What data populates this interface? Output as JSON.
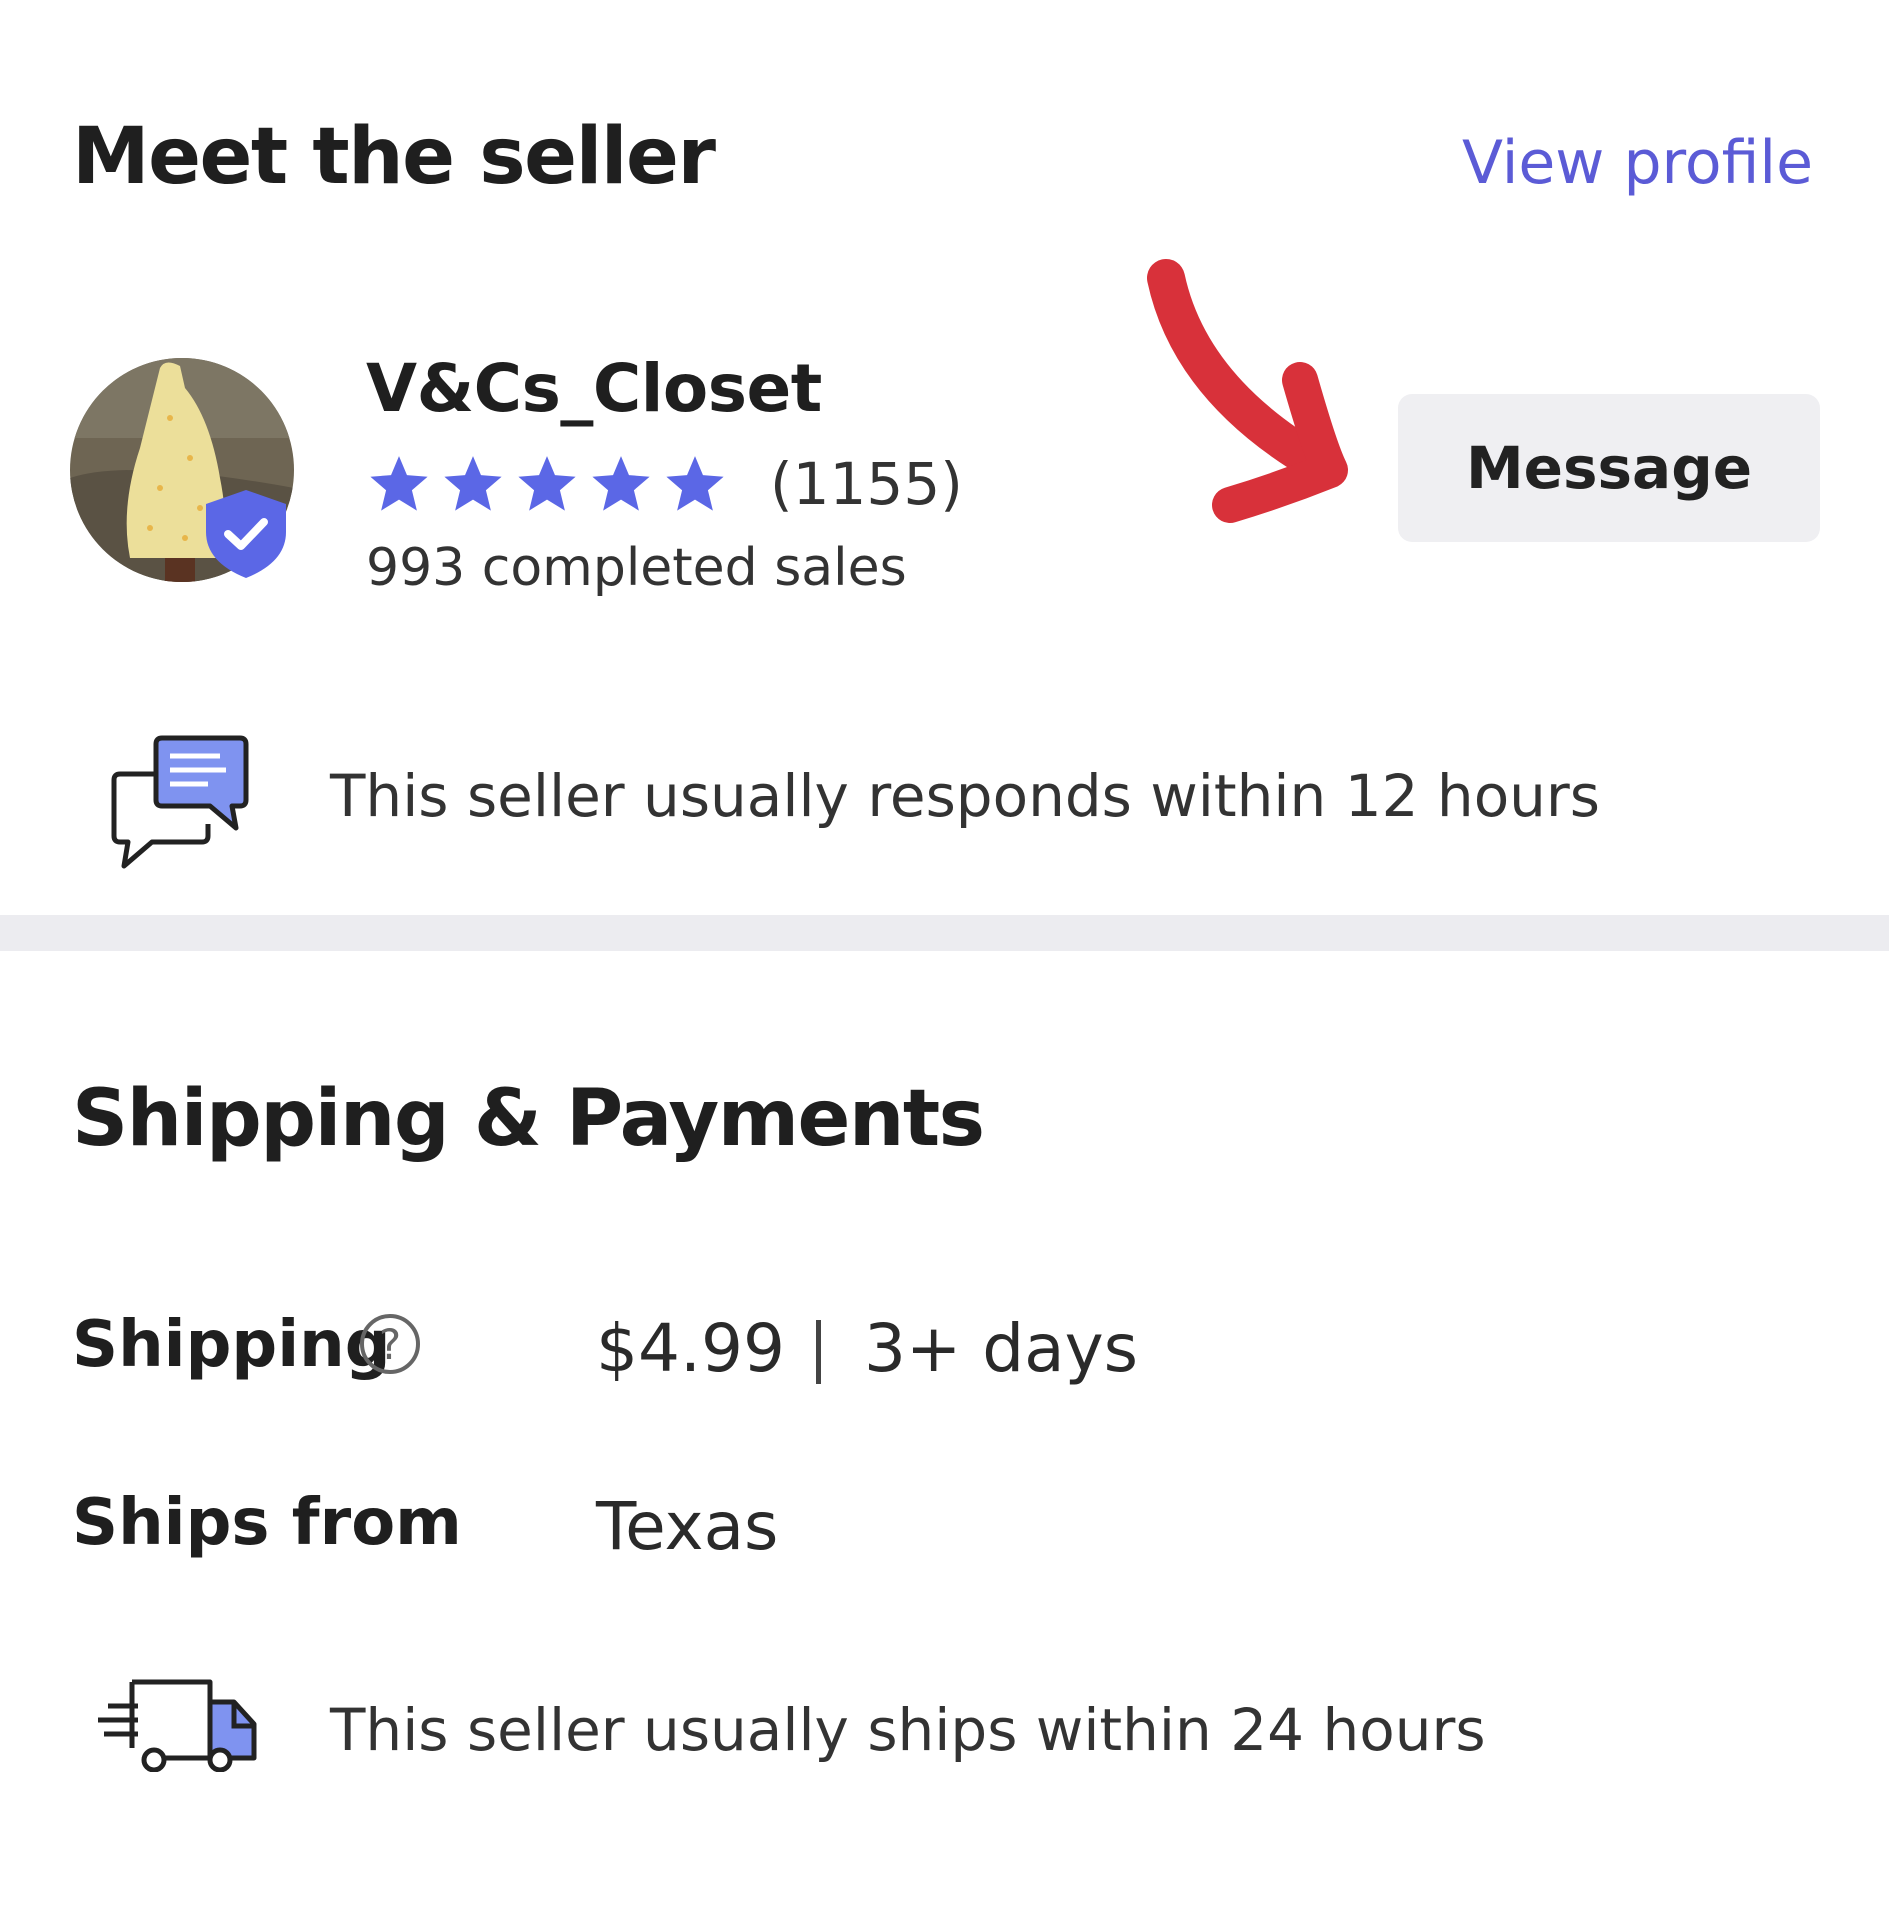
{
  "seller_section": {
    "title": "Meet the seller",
    "view_profile_label": "View profile",
    "seller_name": "V&Cs_Closet",
    "rating_stars": 5,
    "review_count": "(1155)",
    "completed_sales": "993 completed sales",
    "message_label": "Message",
    "response_note": "This seller usually responds within 12 hours",
    "accent_color": "#5b5bd6",
    "annotation_arrow_color": "#d8313a"
  },
  "shipping_section": {
    "title": "Shipping & Payments",
    "rows": [
      {
        "label": "Shipping",
        "value": "$4.99",
        "extra": "3+ days"
      },
      {
        "label": "Ships from",
        "value": "Texas"
      }
    ],
    "ship_note": "This seller usually ships within 24 hours"
  },
  "icons": [
    "verified-shield-icon",
    "chat-bubbles-icon",
    "help-icon",
    "truck-icon",
    "star-icon"
  ]
}
